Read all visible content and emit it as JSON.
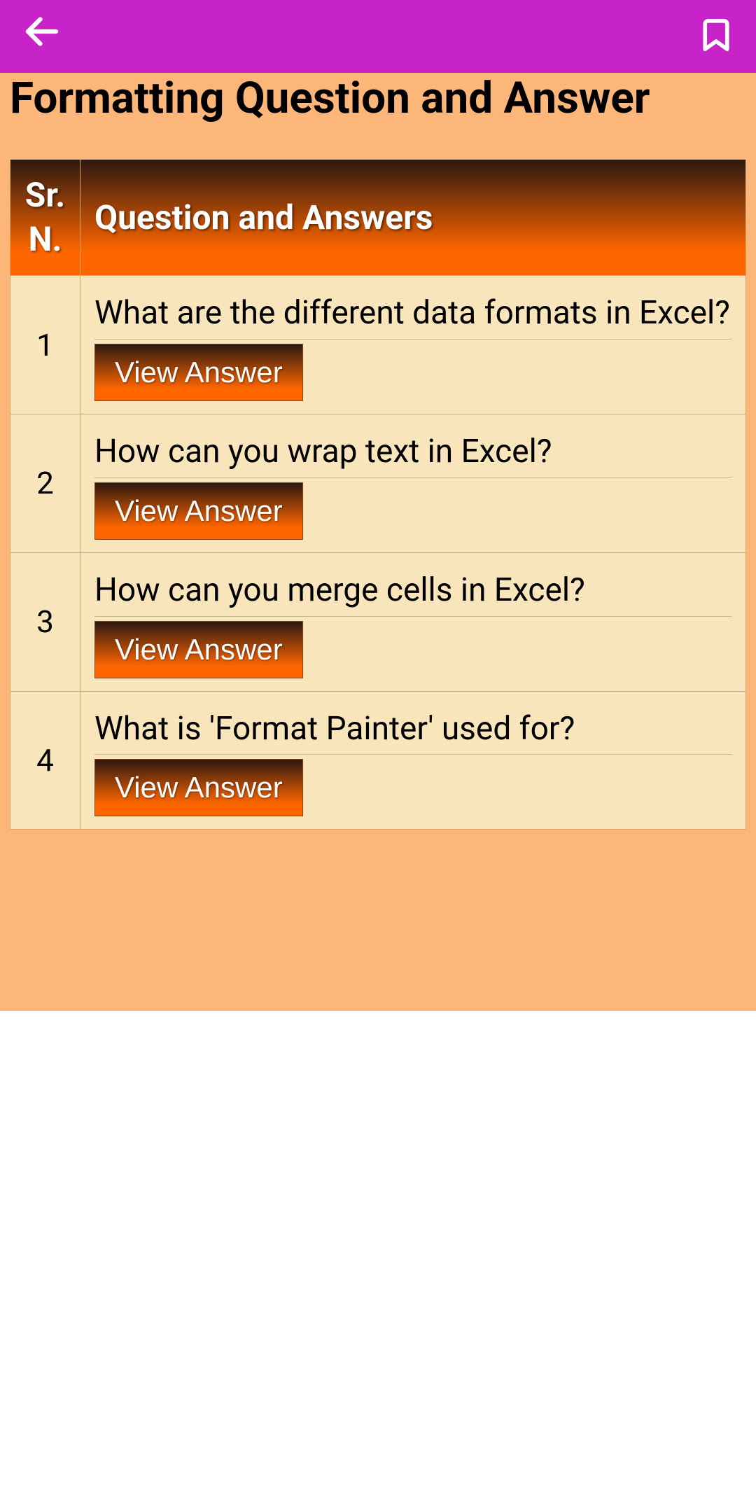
{
  "header": {
    "back_icon": "arrow-left",
    "bookmark_icon": "bookmark"
  },
  "page": {
    "title": "Formatting Question and Answer"
  },
  "table": {
    "headers": {
      "sr_no": "Sr. N.",
      "qa": "Question and Answers"
    },
    "rows": [
      {
        "sr": "1",
        "question": "What are the different data formats in Excel?",
        "button_label": "View Answer"
      },
      {
        "sr": "2",
        "question": "How can you wrap text in Excel?",
        "button_label": "View Answer"
      },
      {
        "sr": "3",
        "question": "How can you merge cells in Excel?",
        "button_label": "View Answer"
      },
      {
        "sr": "4",
        "question": "What is 'Format Painter' used for?",
        "button_label": "View Answer"
      }
    ]
  }
}
